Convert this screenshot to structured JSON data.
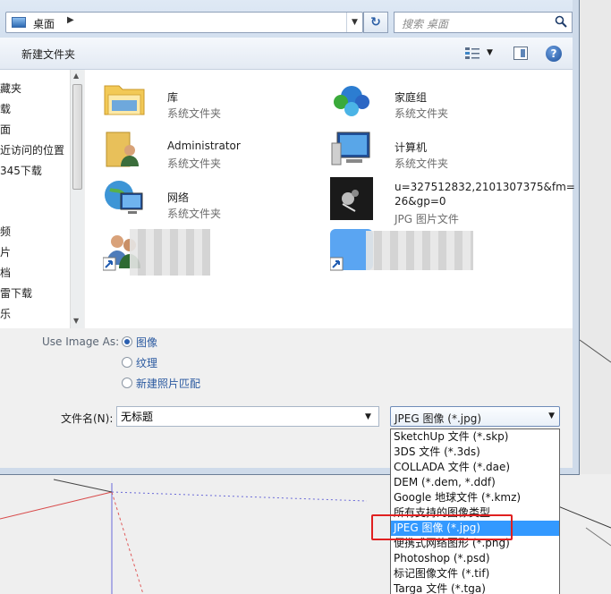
{
  "address": {
    "location": "桌面",
    "search_placeholder": "搜索 桌面"
  },
  "toolbar": {
    "new_folder": "新建文件夹"
  },
  "nav": {
    "items": [
      "藏夹",
      "载",
      "面",
      "近访问的位置",
      "345下载",
      "",
      "频",
      "片",
      "档",
      "雷下载",
      "乐"
    ]
  },
  "files": {
    "library": {
      "name": "库",
      "type": "系统文件夹"
    },
    "homegroup": {
      "name": "家庭组",
      "type": "系统文件夹"
    },
    "admin": {
      "name": "Administrator",
      "type": "系统文件夹"
    },
    "computer": {
      "name": "计算机",
      "type": "系统文件夹"
    },
    "network": {
      "name": "网络",
      "type": "系统文件夹"
    },
    "jpg": {
      "name_line1": "u=327512832,2101307375&fm=",
      "name_line2": "26&gp=0",
      "type": "JPG 图片文件"
    }
  },
  "options": {
    "use_image_as": "Use Image As:",
    "radios": [
      "图像",
      "纹理",
      "新建照片匹配"
    ],
    "filename_label": "文件名(N):",
    "filename_value": "无标题",
    "filetype_selected": "JPEG 图像 (*.jpg)"
  },
  "filetype_options": [
    "SketchUp 文件 (*.skp)",
    "3DS 文件 (*.3ds)",
    "COLLADA 文件 (*.dae)",
    "DEM (*.dem, *.ddf)",
    "Google 地球文件 (*.kmz)",
    "所有支持的图像类型",
    "JPEG 图像 (*.jpg)",
    "便携式网络图形 (*.png)",
    "Photoshop (*.psd)",
    "标记图像文件 (*.tif)",
    "Targa 文件 (*.tga)"
  ],
  "colors": {
    "selection": "#3399ff",
    "annotation": "#e02020"
  }
}
